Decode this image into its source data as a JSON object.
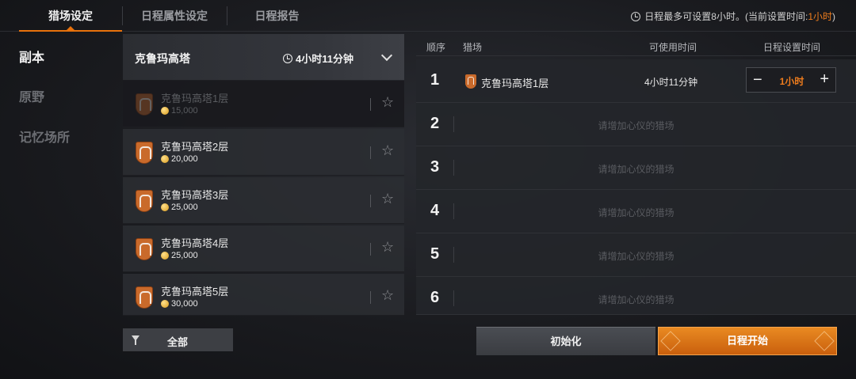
{
  "tabs": [
    {
      "label": "猎场设定"
    },
    {
      "label": "日程属性设定"
    },
    {
      "label": "日程报告"
    }
  ],
  "notice": {
    "text": "日程最多可设置8小时。(当前设置时间:",
    "value": "1小时",
    "suffix": ")"
  },
  "categories": [
    {
      "label": "副本"
    },
    {
      "label": "原野"
    },
    {
      "label": "记忆场所"
    }
  ],
  "header": {
    "title": "克鲁玛高塔",
    "time": "4小时11分钟"
  },
  "hunts": [
    {
      "name": "克鲁玛高塔1层",
      "cost": "15,000"
    },
    {
      "name": "克鲁玛高塔2层",
      "cost": "20,000"
    },
    {
      "name": "克鲁玛高塔3层",
      "cost": "25,000"
    },
    {
      "name": "克鲁玛高塔4层",
      "cost": "25,000"
    },
    {
      "name": "克鲁玛高塔5层",
      "cost": "30,000"
    }
  ],
  "filter": {
    "label": "全部"
  },
  "table": {
    "headers": {
      "order": "顺序",
      "hunt": "猎场",
      "available": "可使用时间",
      "scheduled": "日程设置时间"
    },
    "rows": [
      {
        "num": "1",
        "hunt": "克鲁玛高塔1层",
        "available": "4小时11分钟",
        "scheduled": "1小时"
      },
      {
        "num": "2",
        "empty": "请增加心仪的猎场"
      },
      {
        "num": "3",
        "empty": "请增加心仪的猎场"
      },
      {
        "num": "4",
        "empty": "请增加心仪的猎场"
      },
      {
        "num": "5",
        "empty": "请增加心仪的猎场"
      },
      {
        "num": "6",
        "empty": "请增加心仪的猎场"
      }
    ]
  },
  "buttons": {
    "reset": "初始化",
    "start": "日程开始"
  },
  "colors": {
    "accent": "#e8720c",
    "highlight": "#f07d1d"
  }
}
